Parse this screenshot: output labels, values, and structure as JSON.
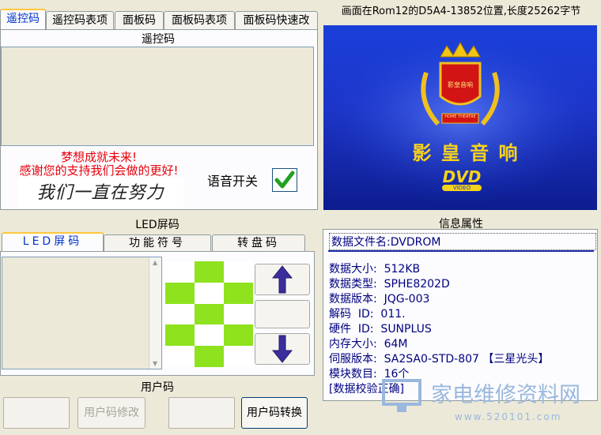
{
  "tabs": [
    "遥控码",
    "遥控码表项",
    "面板码",
    "面板码表项",
    "面板码快速改"
  ],
  "remote": {
    "group_title": "遥控码",
    "motto_line1": "梦想成就未来!",
    "motto_line2": "感谢您的支持我们会做的更好!",
    "signature": "我们一直在努力",
    "voice_label": "语音开关",
    "voice_checked": true
  },
  "led": {
    "group_title": "LED屏码",
    "tabs": [
      "LED屏码",
      "功能符号",
      "转盘码"
    ],
    "grid": [
      [
        0,
        1,
        0
      ],
      [
        1,
        0,
        1
      ],
      [
        0,
        1,
        0
      ],
      [
        1,
        0,
        1
      ],
      [
        0,
        1,
        0
      ]
    ]
  },
  "user": {
    "group_title": "用户码",
    "modify_button": "用户码修改",
    "convert_button": "用户码转换"
  },
  "banner": {
    "header": "画面在Rom12的D5A4-13852位置,长度25262字节",
    "badge_text": "影皇音响",
    "ribbon_text": "HOME THEATRE",
    "brand": "影 皇 音 响",
    "dvd": "DVD",
    "video": "VIDEO"
  },
  "info": {
    "group_title": "信息属性",
    "file_name": "数据文件名:DVDROM",
    "rows": [
      "数据大小:  512KB",
      "数据类型:  SPHE8202D",
      "数据版本:  JQG-003",
      "解码  ID:  011.",
      "硬件  ID:  SUNPLUS",
      "内存大小:  64M",
      "伺服版本:  SA2SA0-STD-807 【三星光头】",
      "模块数目:  16个",
      "[数据校验正确]"
    ]
  },
  "watermark": {
    "text": "家电维修资料网",
    "url": "www.520101.com"
  }
}
